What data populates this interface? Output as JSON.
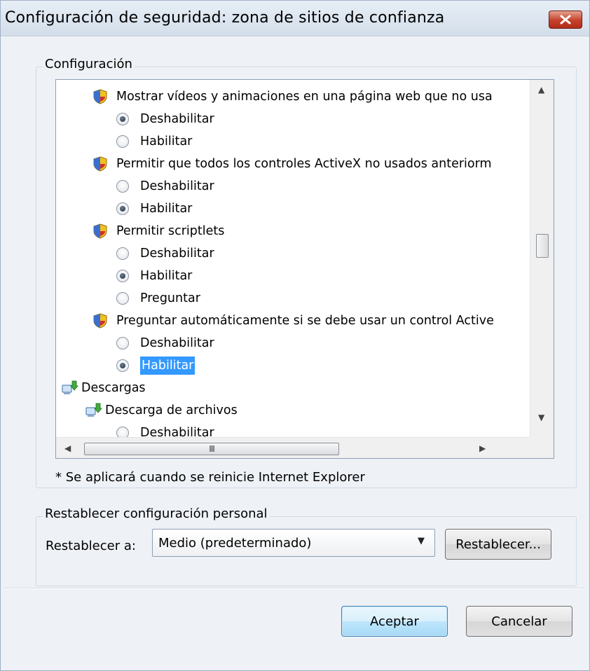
{
  "window": {
    "title": "Configuración de seguridad: zona de sitios de confianza",
    "close_label": "X"
  },
  "settings_group": {
    "legend": "Configuración",
    "tree": [
      {
        "kind": "setting",
        "label": "Mostrar vídeos y animaciones en una página web que no usa"
      },
      {
        "kind": "option",
        "label": "Deshabilitar",
        "checked": true
      },
      {
        "kind": "option",
        "label": "Habilitar",
        "checked": false
      },
      {
        "kind": "setting",
        "label": "Permitir que todos los controles ActiveX no usados anteriorm"
      },
      {
        "kind": "option",
        "label": "Deshabilitar",
        "checked": false
      },
      {
        "kind": "option",
        "label": "Habilitar",
        "checked": true
      },
      {
        "kind": "setting",
        "label": "Permitir scriptlets"
      },
      {
        "kind": "option",
        "label": "Deshabilitar",
        "checked": false
      },
      {
        "kind": "option",
        "label": "Habilitar",
        "checked": true
      },
      {
        "kind": "option",
        "label": "Preguntar",
        "checked": false
      },
      {
        "kind": "setting",
        "label": "Preguntar automáticamente si se debe usar un control Active"
      },
      {
        "kind": "option",
        "label": "Deshabilitar",
        "checked": false
      },
      {
        "kind": "option",
        "label": "Habilitar",
        "checked": true,
        "selected": true
      },
      {
        "kind": "category",
        "label": "Descargas"
      },
      {
        "kind": "subcategory",
        "label": "Descarga de archivos"
      },
      {
        "kind": "option-sub",
        "label": "Deshabilitar",
        "checked": false
      }
    ],
    "hscroll_grip": "III",
    "note": "* Se aplicará cuando se reinicie Internet Explorer"
  },
  "reset_group": {
    "legend": "Restablecer configuración personal",
    "label": "Restablecer a:",
    "selected_value": "Medio (predeterminado)",
    "reset_button": "Restablecer..."
  },
  "footer": {
    "ok_button": "Aceptar",
    "cancel_button": "Cancelar"
  },
  "colors": {
    "selection": "#3399ff",
    "close_button": "#c5412a",
    "dialog_background": "#eef1f6"
  },
  "icons": {
    "setting": "security-setting-icon",
    "category": "download-icon",
    "option": "radio-button"
  }
}
